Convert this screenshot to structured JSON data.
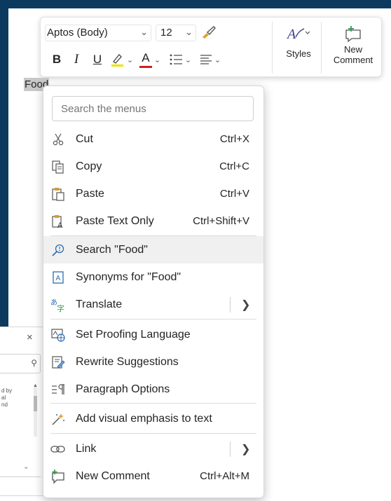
{
  "toolbar": {
    "font_name": "Aptos (Body)",
    "font_size": "12",
    "bold": "B",
    "italic": "I",
    "underline": "U",
    "font_color_letter": "A",
    "highlight_color": "#e8e600",
    "font_color": "#d01f1f",
    "styles_label": "Styles",
    "new_comment_label": "New Comment"
  },
  "document": {
    "selected_word": "Food"
  },
  "side_pane": {
    "close": "×",
    "text_lines": [
      "d by",
      "al",
      "nd"
    ]
  },
  "context_menu": {
    "search_placeholder": "Search the menus",
    "items": [
      {
        "label": "Cut",
        "shortcut": "Ctrl+X",
        "icon": "scissors-icon"
      },
      {
        "label": "Copy",
        "shortcut": "Ctrl+C",
        "icon": "copy-icon"
      },
      {
        "label": "Paste",
        "shortcut": "Ctrl+V",
        "icon": "paste-icon"
      },
      {
        "label": "Paste Text Only",
        "shortcut": "Ctrl+Shift+V",
        "icon": "paste-text-only-icon"
      },
      {
        "label": "Search \"Food\"",
        "shortcut": "",
        "icon": "search-icon"
      },
      {
        "label": "Synonyms for \"Food\"",
        "shortcut": "",
        "icon": "synonyms-icon"
      },
      {
        "label": "Translate",
        "shortcut": "",
        "icon": "translate-icon"
      },
      {
        "label": "Set Proofing Language",
        "shortcut": "",
        "icon": "proofing-language-icon"
      },
      {
        "label": "Rewrite Suggestions",
        "shortcut": "",
        "icon": "rewrite-icon"
      },
      {
        "label": "Paragraph Options",
        "shortcut": "",
        "icon": "paragraph-icon"
      },
      {
        "label": "Add visual emphasis to text",
        "shortcut": "",
        "icon": "visual-emphasis-icon"
      },
      {
        "label": "Link",
        "shortcut": "",
        "icon": "link-icon"
      },
      {
        "label": "New Comment",
        "shortcut": "Ctrl+Alt+M",
        "icon": "new-comment-icon"
      }
    ]
  }
}
